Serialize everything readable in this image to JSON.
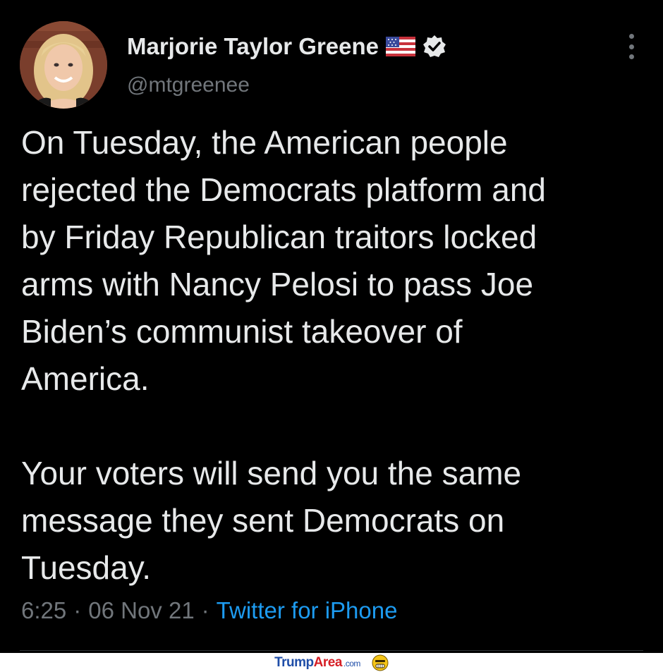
{
  "tweet": {
    "display_name": "Marjorie Taylor Greene",
    "handle": "@mtgreenee",
    "flag_icon": "us-flag-icon",
    "verified_icon": "verified-badge-icon",
    "more_icon": "more-vertical-icon",
    "paragraphs": [
      "On Tuesday, the American people\nrejected the Democrats platform and\nby Friday Republican traitors locked\narms with Nancy Pelosi to pass Joe\nBiden’s communist takeover of\nAmerica.",
      "Your voters will send you the same\nmessage they sent Democrats on\nTuesday."
    ],
    "time": "6:25",
    "separator": "·",
    "date": "06 Nov 21",
    "source": "Twitter for iPhone"
  },
  "watermark": {
    "part1": "Trump",
    "part2": "Area",
    "part3": ".com"
  },
  "colors": {
    "background": "#000000",
    "text": "#e7e9ea",
    "muted": "#71767b",
    "link": "#1d9bf0"
  }
}
